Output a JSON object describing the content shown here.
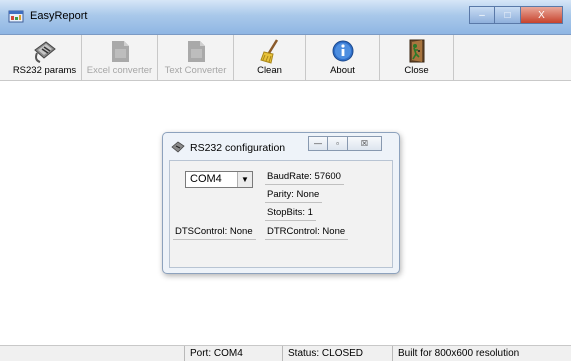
{
  "window": {
    "title": "EasyReport",
    "caption_buttons": {
      "minimize": "–",
      "maximize": "□",
      "close": "X"
    }
  },
  "toolbar": {
    "buttons": [
      {
        "label": "RS232 params",
        "icon": "serial-connector-icon",
        "enabled": true
      },
      {
        "label": "Excel converter",
        "icon": "document-icon",
        "enabled": false
      },
      {
        "label": "Text Converter",
        "icon": "document-icon",
        "enabled": false
      },
      {
        "label": "Clean",
        "icon": "broom-icon",
        "enabled": true
      },
      {
        "label": "About",
        "icon": "info-icon",
        "enabled": true
      },
      {
        "label": "Close",
        "icon": "door-exit-icon",
        "enabled": true
      }
    ]
  },
  "dialog": {
    "title": "RS232 configuration",
    "caption_buttons": {
      "minimize": "—",
      "maximize": "▫",
      "close": "☒"
    },
    "port_select": {
      "value": "COM4",
      "arrow": "▼"
    },
    "baud_rate": "BaudRate: 57600",
    "parity": "Parity: None",
    "stop_bits": "StopBits: 1",
    "dts_control": "DTSControl: None",
    "dtr_control": "DTRControl: None"
  },
  "statusbar": {
    "port": "Port: COM4",
    "status": "Status: CLOSED",
    "resolution": "Built for 800x600 resolution"
  },
  "colors": {
    "titlebar": "#a9c8ea",
    "close_button": "#c7422c",
    "dialog_background": "#eef3f9",
    "disabled_text": "#a6a6a6"
  }
}
